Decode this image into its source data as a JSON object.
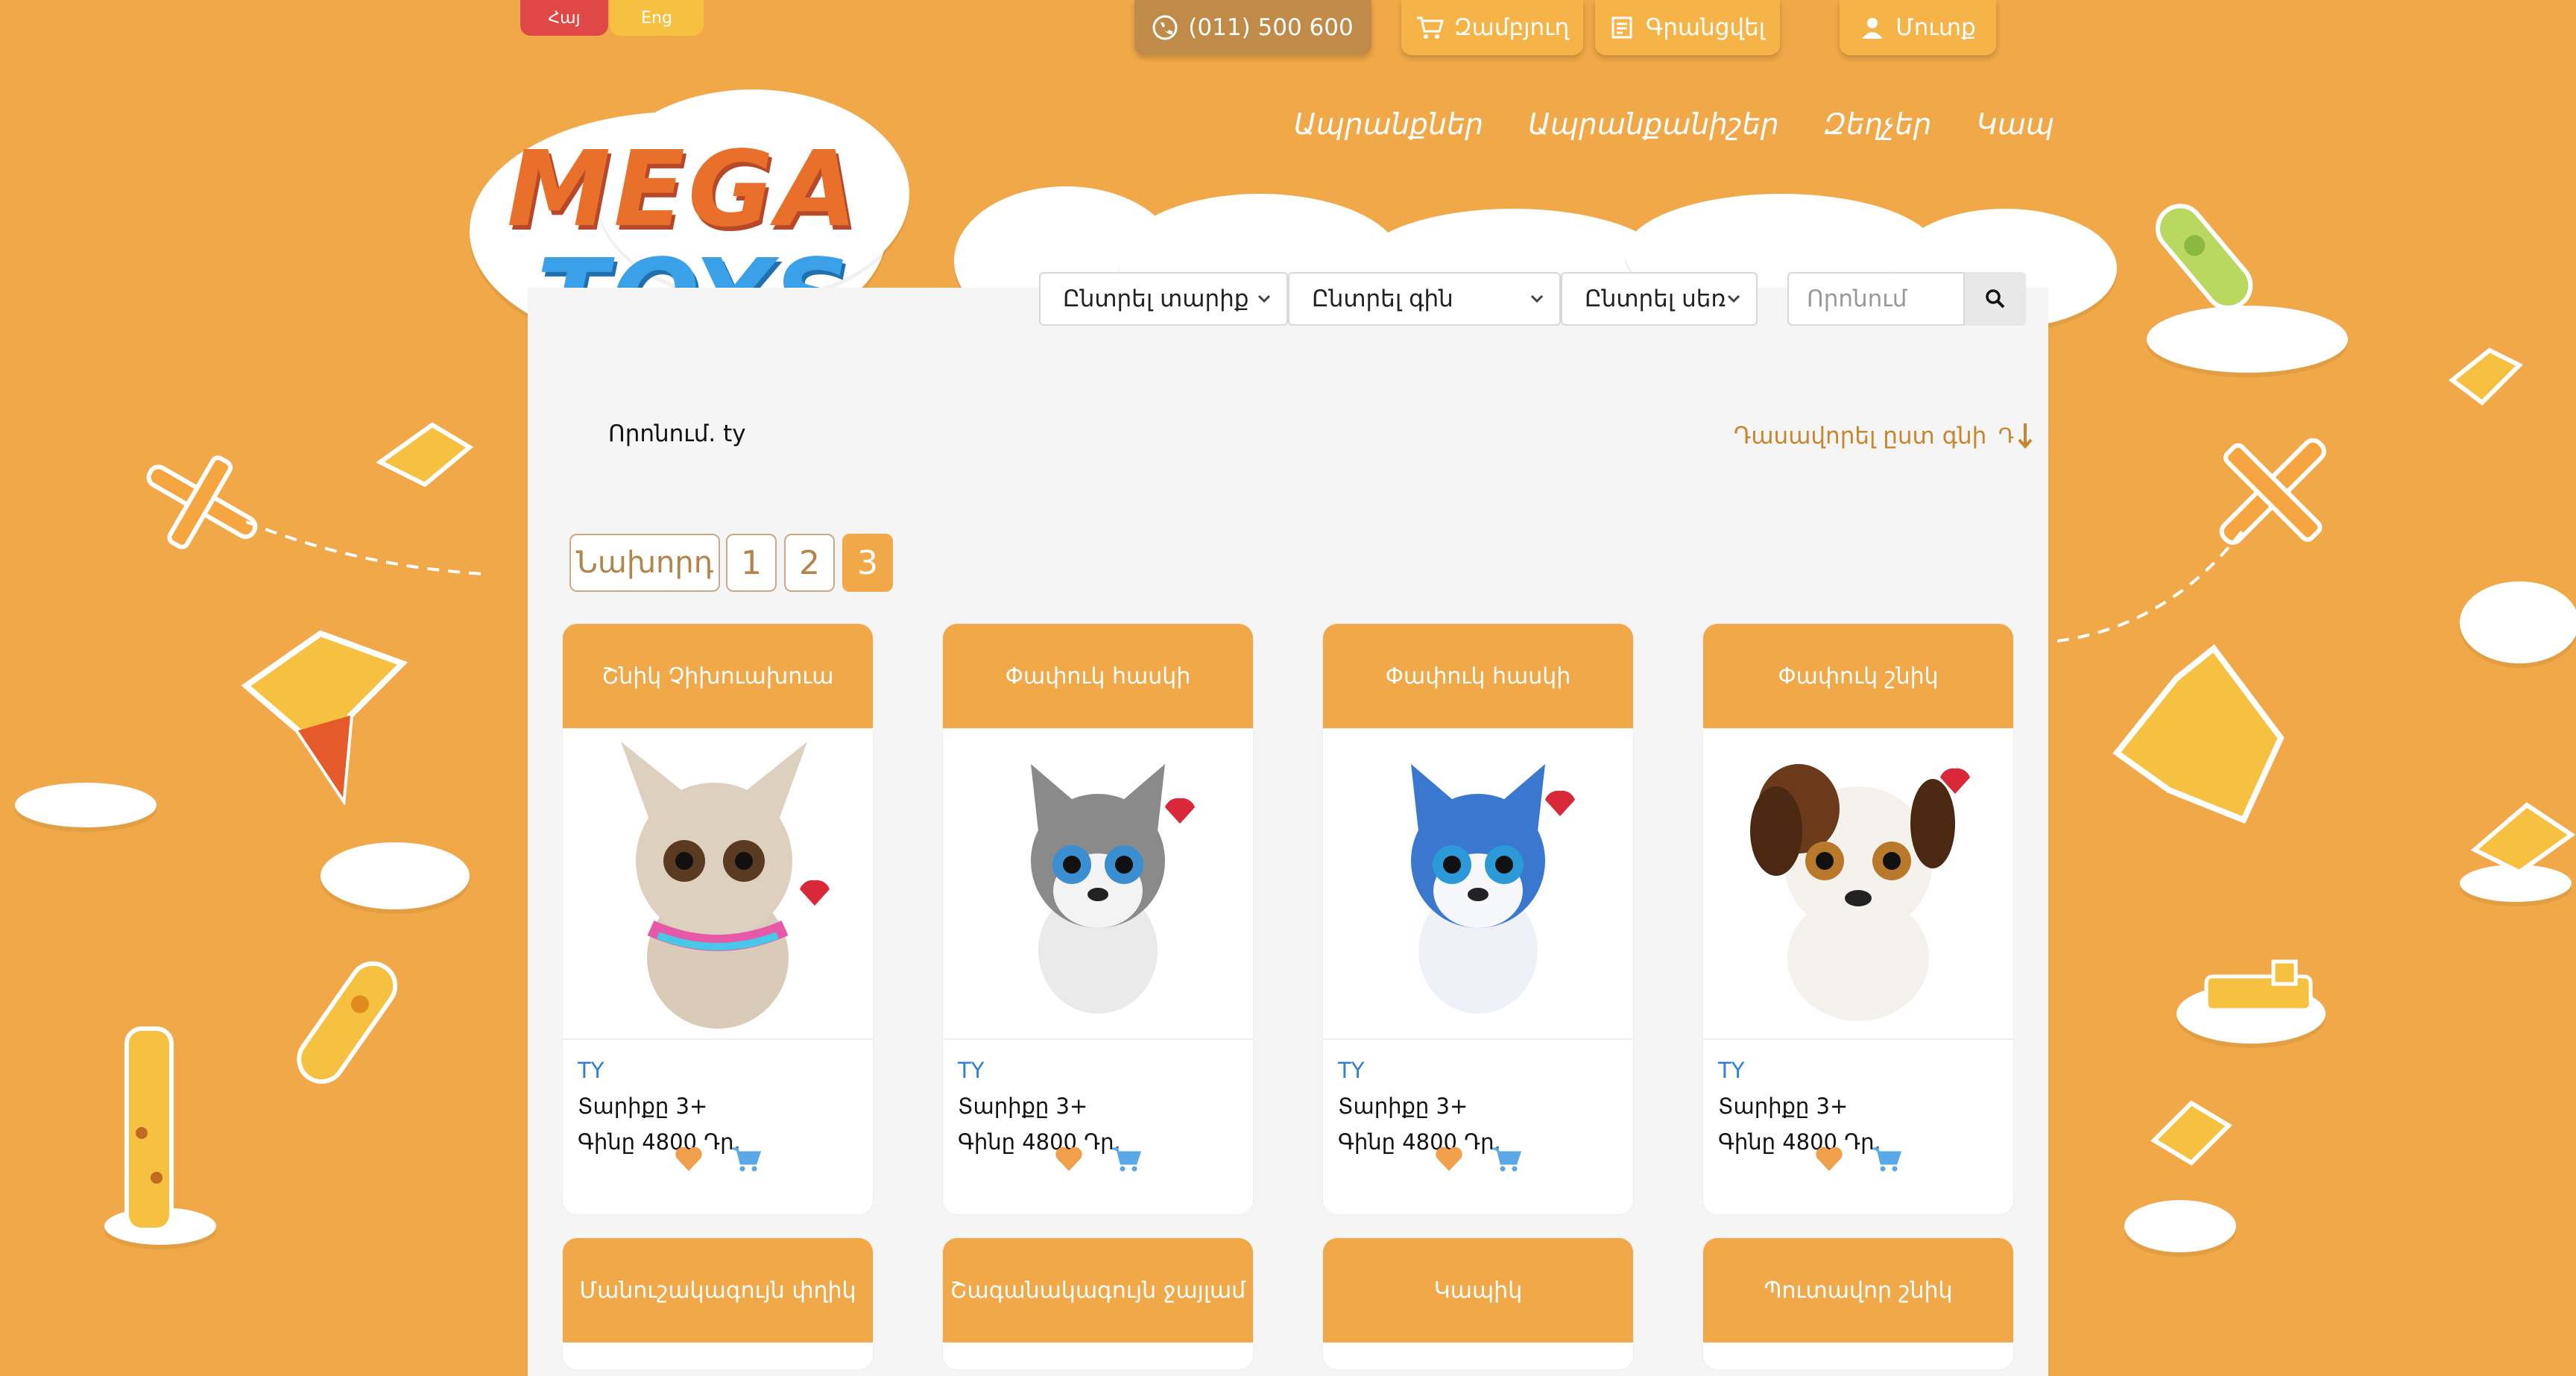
{
  "lang": {
    "hy": "Հայ",
    "en": "Eng"
  },
  "top": {
    "phone": "(011) 500 600",
    "cart": "Զամբյուղ",
    "orders": "Գրանցվել",
    "login": "Մուտք"
  },
  "nav": [
    "Ապրանքներ",
    "Ապրանքանիշեր",
    "Զեղչեր",
    "Կապ"
  ],
  "filters": {
    "age": "Ընտրել տարիք",
    "price": "Ընտրել գին",
    "gender": "Ընտրել սեռ",
    "search_placeholder": "Որոնում"
  },
  "search_label": "Որոնում. ty",
  "sort_label": "Դասավորել ըստ գնի",
  "pagination": {
    "prev": "Նախորդ",
    "pages": [
      "1",
      "2",
      "3"
    ],
    "active": "3"
  },
  "products": [
    {
      "name": "Շնիկ Չիխուախուա",
      "brand": "TY",
      "age": "Տարիքը 3+",
      "price": "Գինը 4800 Դր."
    },
    {
      "name": "Փափուկ հասկի",
      "brand": "TY",
      "age": "Տարիքը 3+",
      "price": "Գինը 4800 Դր."
    },
    {
      "name": "Փափուկ հասկի",
      "brand": "TY",
      "age": "Տարիքը 3+",
      "price": "Գինը 4800 Դր."
    },
    {
      "name": "Փափուկ շնիկ",
      "brand": "TY",
      "age": "Տարիքը 3+",
      "price": "Գինը 4800 Դր."
    },
    {
      "name": "Մանուշակագույն փղիկ"
    },
    {
      "name": "Շագանակագույն ջայլամ"
    },
    {
      "name": "Կապիկ"
    },
    {
      "name": "Պուտավոր շնիկ"
    }
  ],
  "logo": {
    "line1": "MEGA",
    "line2": "TOYS"
  },
  "colors": {
    "accent": "#f0a848",
    "brand_link": "#2f7fd6",
    "lang_active": "#e04848"
  }
}
